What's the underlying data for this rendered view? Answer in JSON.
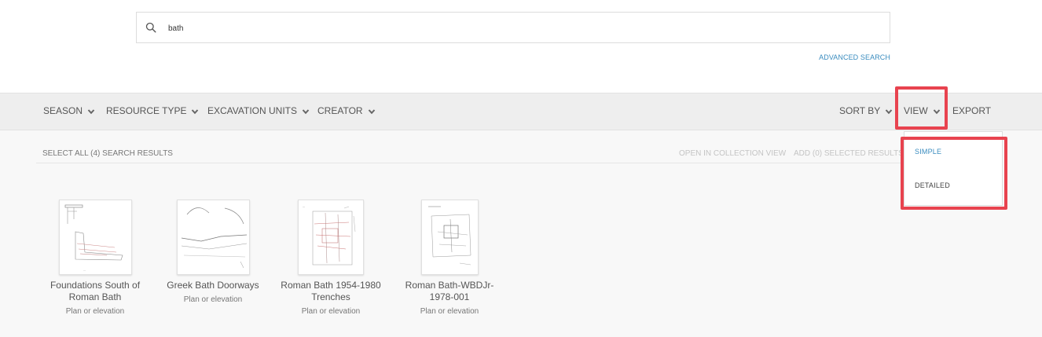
{
  "search": {
    "value": "bath",
    "placeholder": ""
  },
  "advanced_search_label": "ADVANCED SEARCH",
  "filters": [
    {
      "label": "SEASON"
    },
    {
      "label": "RESOURCE TYPE"
    },
    {
      "label": "EXCAVATION UNITS"
    },
    {
      "label": "CREATOR"
    }
  ],
  "right_controls": {
    "sort_by": "SORT BY",
    "view": "VIEW",
    "export": "EXPORT"
  },
  "results_bar": {
    "select_all": "SELECT ALL (4) SEARCH RESULTS",
    "open_collection": "OPEN IN COLLECTION VIEW",
    "add_selected": "ADD (0) SELECTED RESULTS"
  },
  "results": [
    {
      "title_line1": "Foundations South of",
      "title_line2": "Roman Bath",
      "type": "Plan or elevation"
    },
    {
      "title_line1": "Greek Bath Doorways",
      "title_line2": "",
      "type": "Plan or elevation"
    },
    {
      "title_line1": "Roman Bath 1954-1980",
      "title_line2": "Trenches",
      "type": "Plan or elevation"
    },
    {
      "title_line1": "Roman Bath-WBDJr-",
      "title_line2": "1978-001",
      "type": "Plan or elevation"
    }
  ],
  "view_menu": {
    "options": [
      "SIMPLE",
      "DETAILED"
    ],
    "selected": "SIMPLE"
  },
  "colors": {
    "accent": "#3a8cbf",
    "highlight": "#e8434f",
    "bar": "#eeeeee"
  }
}
